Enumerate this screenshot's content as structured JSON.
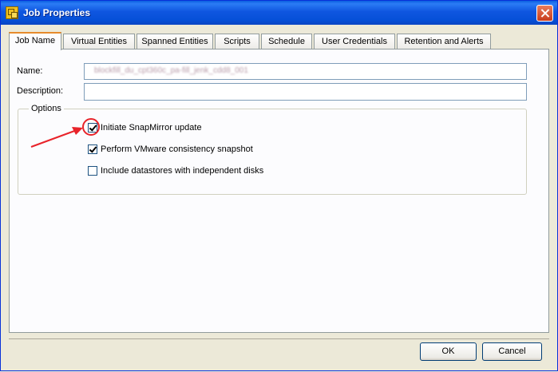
{
  "window": {
    "title": "Job Properties"
  },
  "tabs": [
    {
      "label": "Job Name",
      "active": true
    },
    {
      "label": "Virtual Entities"
    },
    {
      "label": "Spanned Entities"
    },
    {
      "label": "Scripts"
    },
    {
      "label": "Schedule"
    },
    {
      "label": "User Credentials"
    },
    {
      "label": "Retention and Alerts"
    }
  ],
  "form": {
    "name_label": "Name:",
    "name_value": "blockfill_du_cpt360c_pa-fill_jenk_cdd8_001",
    "description_label": "Description:",
    "description_value": ""
  },
  "options": {
    "legend": "Options",
    "items": [
      {
        "label": "Initiate SnapMirror update",
        "checked": true
      },
      {
        "label": "Perform VMware consistency snapshot",
        "checked": true
      },
      {
        "label": "Include datastores with independent disks",
        "checked": false
      }
    ]
  },
  "buttons": {
    "ok": "OK",
    "cancel": "Cancel"
  },
  "colors": {
    "title_bar": "#0a5fe0",
    "annotation": "#e8232a",
    "active_tab_accent": "#e68b2c"
  }
}
